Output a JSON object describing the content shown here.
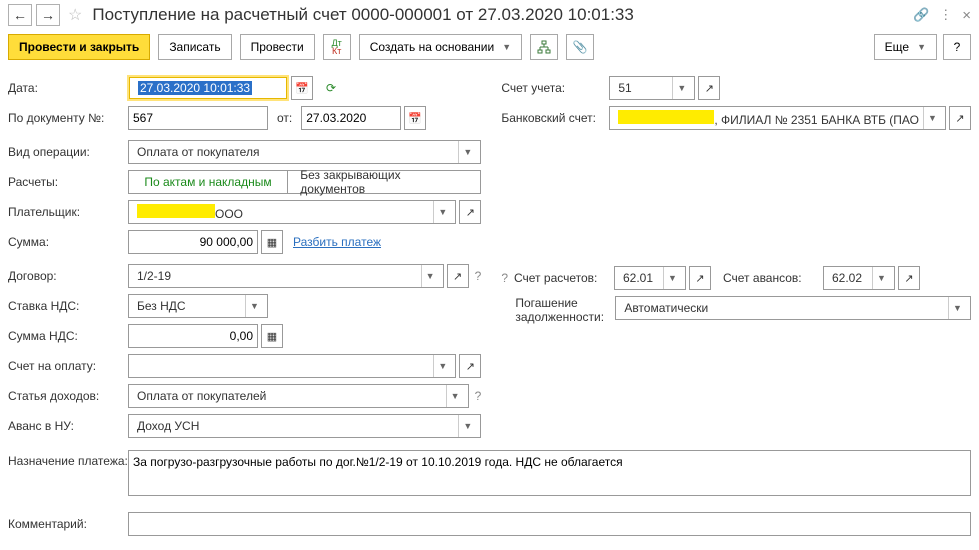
{
  "title": "Поступление на расчетный счет 0000-000001 от 27.03.2020 10:01:33",
  "toolbar": {
    "post_close": "Провести и закрыть",
    "save": "Записать",
    "post": "Провести",
    "create_based": "Создать на основании",
    "more": "Еще"
  },
  "labels": {
    "date": "Дата:",
    "doc_no": "По документу №:",
    "ot": "от:",
    "op_type": "Вид операции:",
    "calc": "Расчеты:",
    "payer": "Плательщик:",
    "sum": "Сумма:",
    "contract": "Договор:",
    "vat_rate": "Ставка НДС:",
    "vat_sum": "Сумма НДС:",
    "invoice": "Счет на оплату:",
    "income_item": "Статья доходов:",
    "advance_nu": "Аванс в НУ:",
    "purpose": "Назначение платежа:",
    "comment": "Комментарий:",
    "account": "Счет учета:",
    "bank_account": "Банковский счет:",
    "settle_account": "Счет расчетов:",
    "advance_account": "Счет авансов:",
    "debt_repay": "Погашение задолженности:"
  },
  "values": {
    "date": "27.03.2020 10:01:33",
    "doc_no": "567",
    "doc_date": "27.03.2020",
    "op_type": "Оплата от покупателя",
    "seg_active": "По актам и накладным",
    "seg_inactive": "Без закрывающих документов",
    "payer_suffix": "ООО",
    "sum": "90 000,00",
    "split_link": "Разбить платеж",
    "contract": "1/2-19",
    "vat_rate": "Без НДС",
    "vat_sum": "0,00",
    "invoice": "",
    "income_item": "Оплата от покупателей",
    "advance_nu": "Доход УСН",
    "purpose": "За погрузо-разгрузочные работы по дог.№1/2-19 от 10.10.2019 года. НДС не облагается",
    "comment": "",
    "account": "51",
    "bank_account_suffix": ", ФИЛИАЛ № 2351 БАНКА ВТБ (ПАО",
    "settle_account": "62.01",
    "advance_account": "62.02",
    "debt_repay": "Автоматически"
  }
}
